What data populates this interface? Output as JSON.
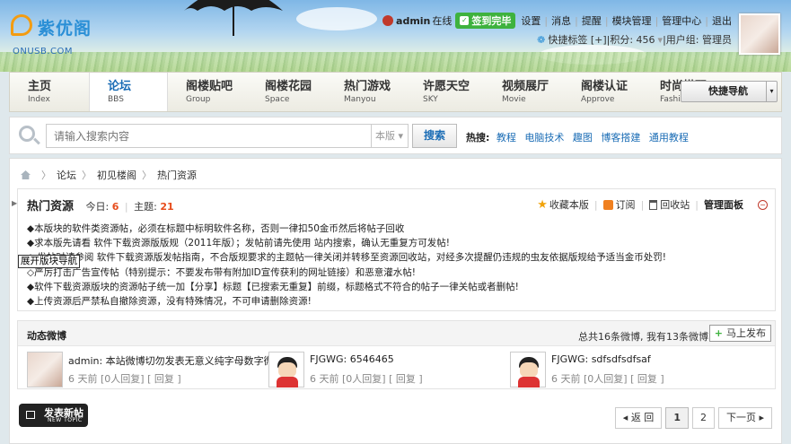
{
  "logo": {
    "text": "紫优阁",
    "domain": "ONUSB.COM"
  },
  "user_bar": {
    "username": "admin",
    "online": "在线",
    "signin": "签到完毕",
    "links": [
      "设置",
      "消息",
      "提醒",
      "模块管理",
      "管理中心",
      "退出"
    ],
    "quick_tag": "快捷标签 [+]",
    "points": "积分: 456",
    "group": "用户组: 管理员"
  },
  "nav": {
    "items": [
      {
        "cn": "主页",
        "en": "Index"
      },
      {
        "cn": "论坛",
        "en": "BBS"
      },
      {
        "cn": "阁楼贴吧",
        "en": "Group"
      },
      {
        "cn": "阁楼花园",
        "en": "Space"
      },
      {
        "cn": "热门游戏",
        "en": "Manyou"
      },
      {
        "cn": "许愿天空",
        "en": "SKY"
      },
      {
        "cn": "视频展厅",
        "en": "Movie"
      },
      {
        "cn": "阁楼认证",
        "en": "Approve"
      },
      {
        "cn": "时尚搭配",
        "en": "Fashion"
      }
    ],
    "active_index": 1,
    "quick_nav": "快捷导航"
  },
  "search": {
    "placeholder": "请输入搜索内容",
    "scope": "本版",
    "button": "搜索",
    "hot_label": "热搜:",
    "hot_terms": [
      "教程",
      "电脑技术",
      "趣图",
      "博客搭建",
      "通用教程"
    ]
  },
  "breadcrumb": [
    "论坛",
    "初见楼阁",
    "热门资源"
  ],
  "forum": {
    "title": "热门资源",
    "today_label": "今日:",
    "today": "6",
    "threads_label": "主题:",
    "threads": "21",
    "actions": {
      "favorite": "收藏本版",
      "subscribe": "订阅",
      "recycle": "回收站",
      "panel": "管理面板"
    },
    "tooltip": "展开版块导航",
    "rules": [
      "◆本版块的软件类资源帖，必须在标题中标明软件名称，否则一律扣50金币然后将帖子回收",
      "◆求本版先请看 软件下载资源版版规（2011年版）；发帖前请先使用  站内搜索，确认无重复方可发帖!",
      "◇ 发帖时请参阅 软件下载资源版发帖指南，不合版规要求的主题帖一律关闭并转移至资源回收站，对经多次提醒仍违规的虫友依据版规给予适当金币处罚!",
      "◇严厉打击广告宣传帖（特别提示：不要发布带有附加ID宣传获利的网址链接）和恶意灌水帖!",
      "◆软件下载资源版块的资源帖子统一加【分享】标题【已搜索无重复】前缀，标题格式不符合的帖子一律关帖或者删帖!",
      "◆上传资源后严禁私自撤除资源，没有特殊情况，不可申请删除资源!"
    ]
  },
  "weibo": {
    "title": "动态微博",
    "count": "总共16条微博, 我有13条微博",
    "post_button": "马上发布",
    "items": [
      {
        "text": "admin: 本站微博切勿发表无意义纯字母数字微",
        "meta": "6 天前 [0人回复] [ 回复 ]"
      },
      {
        "text": "FJGWG: 6546465",
        "meta": "6 天前 [0人回复] [ 回复 ]"
      },
      {
        "text": "FJGWG: sdfsdfsdfsaf",
        "meta": "6 天前 [0人回复] [ 回复 ]"
      }
    ]
  },
  "new_post": {
    "cn": "发表新帖",
    "en": "NEW TOPIC"
  },
  "pager": {
    "prev": "◂ 返 回",
    "pages": [
      "1",
      "2"
    ],
    "current": "1",
    "next": "下一页 ▸"
  },
  "colors": {
    "accent": "#1a6cb5",
    "signin": "#3eb23e",
    "highlight": "#e74c1c"
  },
  "icons": [
    "search-icon",
    "home-icon",
    "star-icon",
    "rss-icon",
    "bin-icon",
    "plus-icon",
    "user-icon",
    "check-icon"
  ]
}
